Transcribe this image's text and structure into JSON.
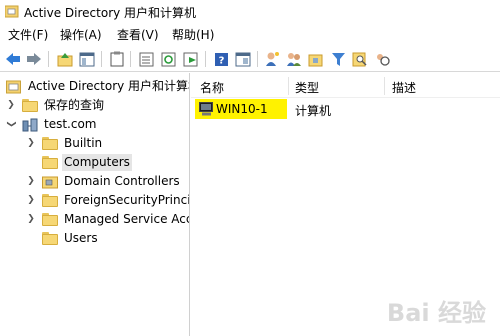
{
  "window": {
    "title": "Active Directory 用户和计算机"
  },
  "menu": {
    "items": [
      "文件(F)",
      "操作(A)",
      "查看(V)",
      "帮助(H)"
    ]
  },
  "toolbar": {
    "icons": [
      "back-arrow-icon",
      "forward-arrow-icon",
      "up-folder-icon",
      "console-tree-icon",
      "clipboard-icon",
      "export-list-icon",
      "refresh-icon",
      "properties-icon",
      "help-icon",
      "console-pane-icon",
      "add-user-icon",
      "add-group-icon",
      "add-ou-icon",
      "filter-icon",
      "find-icon",
      "add-to-group-icon"
    ]
  },
  "tree": {
    "root": "Active Directory 用户和计算机",
    "saved_queries": "保存的查询",
    "domain": "test.com",
    "children": [
      "Builtin",
      "Computers",
      "Domain Controllers",
      "ForeignSecurityPrincipa",
      "Managed Service Acco",
      "Users"
    ],
    "selected": "Computers"
  },
  "list": {
    "headers": [
      "名称",
      "类型",
      "描述"
    ],
    "rows": [
      {
        "name": "WIN10-1",
        "type": "计算机",
        "description": ""
      }
    ],
    "highlight_color": "#fff200"
  },
  "watermark": "Bai 经验"
}
